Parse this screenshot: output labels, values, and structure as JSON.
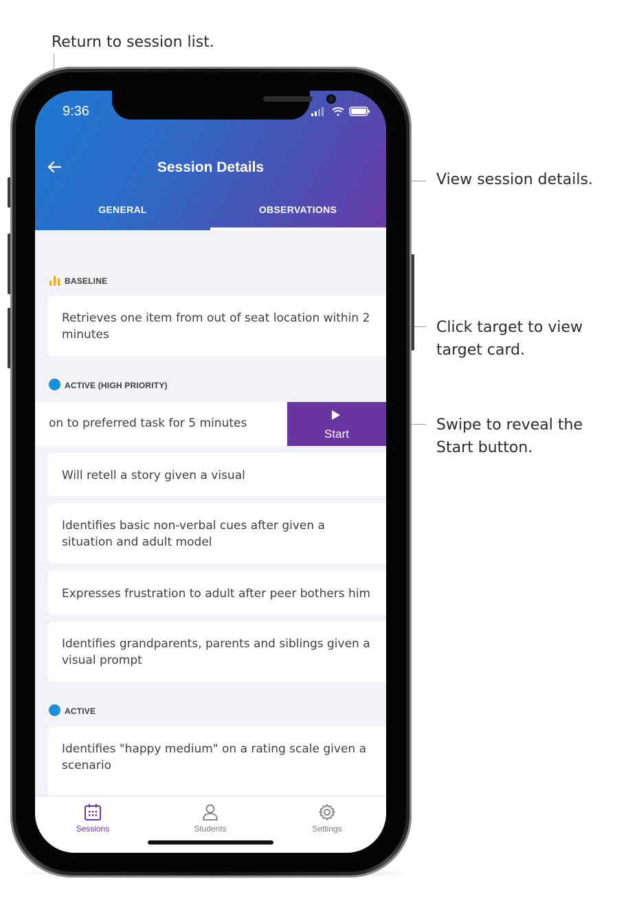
{
  "annotations": {
    "back": "Return to session list.",
    "details": "View session details.",
    "target_line1": "Click target to view",
    "target_line2": "target card.",
    "swipe_line1": "Swipe to reveal the",
    "swipe_line2": "Start button."
  },
  "status_bar": {
    "time": "9:36"
  },
  "header": {
    "back_icon": "arrow-left-icon",
    "title": "Session Details",
    "tabs": [
      {
        "label": "GENERAL",
        "selected": false
      },
      {
        "label": "OBSERVATIONS",
        "selected": true
      }
    ]
  },
  "sections": {
    "baseline": {
      "label": "BASELINE",
      "icon": "bar-chart-icon",
      "icon_color": "#f5a623",
      "items": [
        "Retrieves one item from out of seat location within 2 minutes"
      ]
    },
    "high_priority": {
      "label": "ACTIVE (HIGH PRIORITY)",
      "dot_color": "#1a8fe0",
      "swiped_item": "on to preferred task for 5 minutes",
      "start_label": "Start",
      "items": [
        "Will retell a story given a visual",
        "Identifies basic non-verbal cues after given a situation and adult model",
        "Expresses frustration to adult after peer bothers him",
        "Identifies grandparents, parents and siblings given a visual prompt"
      ]
    },
    "active": {
      "label": "ACTIVE",
      "dot_color": "#1a8fe0",
      "items": [
        "Identifies \"happy medium\" on a rating scale given a scenario"
      ]
    }
  },
  "bottom_nav": [
    {
      "label": "Sessions",
      "icon": "calendar-icon",
      "active": true
    },
    {
      "label": "Students",
      "icon": "person-icon",
      "active": false
    },
    {
      "label": "Settings",
      "icon": "gear-icon",
      "active": false
    }
  ],
  "colors": {
    "accent": "#6b35a1",
    "header_start": "#1e78d2",
    "header_end": "#6b3aa6"
  }
}
